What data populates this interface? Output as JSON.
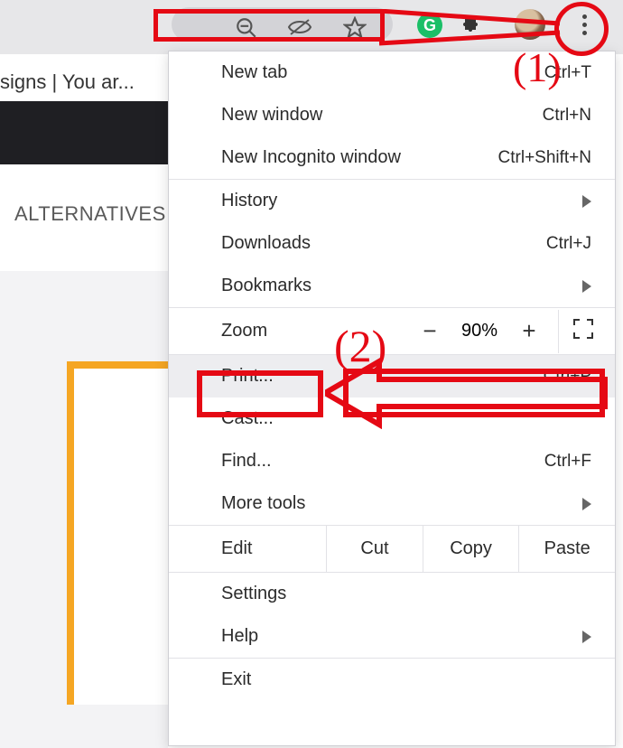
{
  "toolbar": {
    "grammarly_letter": "G"
  },
  "page": {
    "tab_title_fragment": "signs | You ar...",
    "alt_label": "ALTERNATIVES"
  },
  "menu": {
    "items": {
      "new_tab": {
        "label": "New tab",
        "shortcut": "Ctrl+T"
      },
      "new_window": {
        "label": "New window",
        "shortcut": "Ctrl+N"
      },
      "incognito": {
        "label": "New Incognito window",
        "shortcut": "Ctrl+Shift+N"
      },
      "history": {
        "label": "History"
      },
      "downloads": {
        "label": "Downloads",
        "shortcut": "Ctrl+J"
      },
      "bookmarks": {
        "label": "Bookmarks"
      },
      "zoom": {
        "label": "Zoom",
        "value": "90%",
        "minus": "−",
        "plus": "+"
      },
      "print": {
        "label": "Print...",
        "shortcut": "Ctrl+P"
      },
      "cast": {
        "label": "Cast..."
      },
      "find": {
        "label": "Find...",
        "shortcut": "Ctrl+F"
      },
      "more_tools": {
        "label": "More tools"
      },
      "edit": {
        "label": "Edit",
        "cut": "Cut",
        "copy": "Copy",
        "paste": "Paste"
      },
      "settings": {
        "label": "Settings"
      },
      "help": {
        "label": "Help"
      },
      "exit": {
        "label": "Exit"
      }
    }
  },
  "annotations": {
    "step1": "(1)",
    "step2": "(2)"
  }
}
